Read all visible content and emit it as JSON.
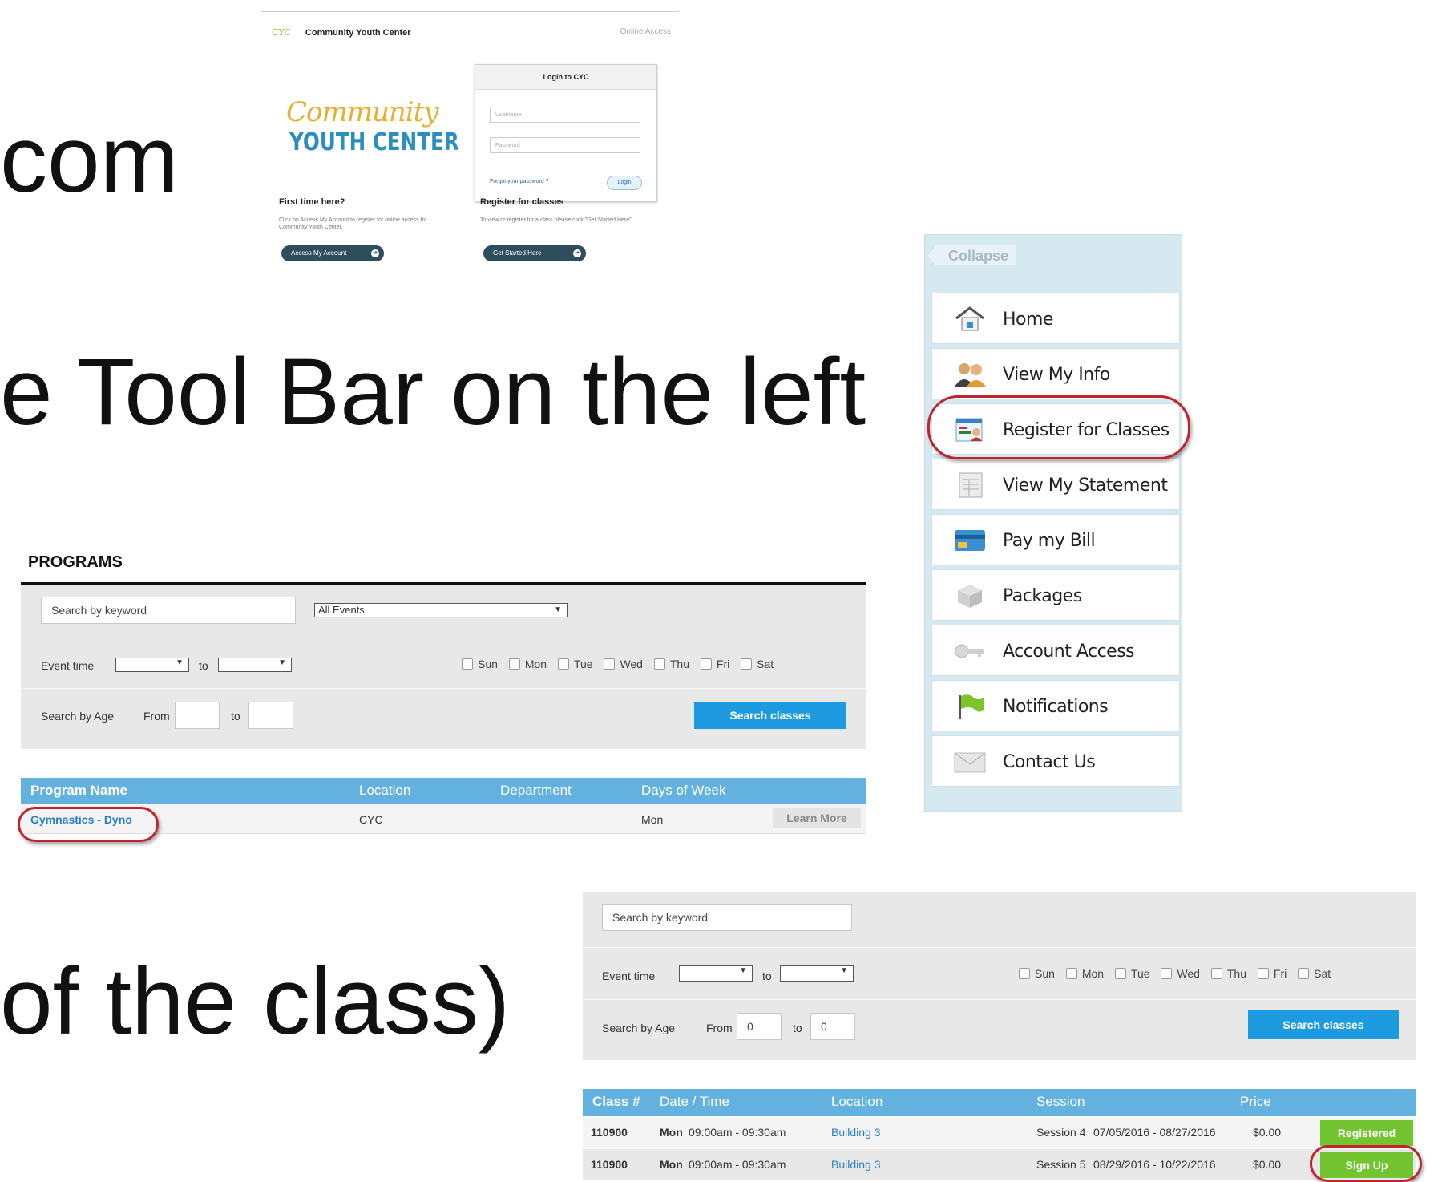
{
  "slide": {
    "fragment_1": "com",
    "fragment_2": "e Tool Bar on the left",
    "fragment_3": "of the class)"
  },
  "login": {
    "brand_short": "CYC",
    "brand_name": "Community Youth Center",
    "online_access": "Online Access",
    "logo_line1": "Community",
    "logo_line2": "YOUTH CENTER",
    "box_title": "Login to CYC",
    "username_placeholder": "Username",
    "password_placeholder": "Password",
    "forgot": "Forgot your password ?",
    "login_button": "Login",
    "first_time_heading": "First time here?",
    "first_time_text": "Click on Access My Account to register for online access for Community Youth Center.",
    "access_button": "Access My Account",
    "register_heading": "Register for classes",
    "register_text": "To view or register for a class please click \"Get Started Here\".",
    "get_started_button": "Get Started Here"
  },
  "sidebar": {
    "collapse": "Collapse",
    "items": [
      {
        "label": "Home",
        "icon": "home-icon"
      },
      {
        "label": "View My Info",
        "icon": "users-icon"
      },
      {
        "label": "Register for Classes",
        "icon": "register-icon"
      },
      {
        "label": "View My Statement",
        "icon": "statement-icon"
      },
      {
        "label": "Pay my Bill",
        "icon": "credit-card-icon"
      },
      {
        "label": "Packages",
        "icon": "package-icon"
      },
      {
        "label": "Account Access",
        "icon": "key-icon"
      },
      {
        "label": "Notifications",
        "icon": "flag-icon"
      },
      {
        "label": "Contact Us",
        "icon": "envelope-icon"
      }
    ]
  },
  "programs": {
    "title": "PROGRAMS",
    "keyword_placeholder": "Search by keyword",
    "events_select": "All Events",
    "event_time_label": "Event time",
    "to": "to",
    "days": [
      "Sun",
      "Mon",
      "Tue",
      "Wed",
      "Thu",
      "Fri",
      "Sat"
    ],
    "age_label": "Search by Age",
    "from": "From",
    "search_button": "Search classes",
    "columns": [
      "Program Name",
      "Location",
      "Department",
      "Days of Week"
    ],
    "row": {
      "name": "Gymnastics - Dyno",
      "location": "CYC",
      "department": "",
      "days": "Mon",
      "action": "Learn More"
    }
  },
  "classes": {
    "keyword_placeholder": "Search by keyword",
    "event_time_label": "Event time",
    "to": "to",
    "days": [
      "Sun",
      "Mon",
      "Tue",
      "Wed",
      "Thu",
      "Fri",
      "Sat"
    ],
    "age_label": "Search by Age",
    "from": "From",
    "age_from": "0",
    "age_to": "0",
    "search_button": "Search classes",
    "columns": [
      "Class #",
      "Date / Time",
      "Location",
      "Session",
      "Price"
    ],
    "rows": [
      {
        "num": "110900",
        "day": "Mon",
        "time": "09:00am - 09:30am",
        "location": "Building 3",
        "session": "Session 4",
        "dates": "07/05/2016 - 08/27/2016",
        "price": "$0.00",
        "action": "Registered"
      },
      {
        "num": "110900",
        "day": "Mon",
        "time": "09:00am - 09:30am",
        "location": "Building 3",
        "session": "Session 5",
        "dates": "08/29/2016 - 10/22/2016",
        "price": "$0.00",
        "action": "Sign Up"
      }
    ]
  }
}
